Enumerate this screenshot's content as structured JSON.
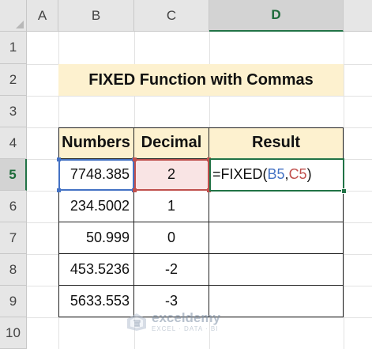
{
  "columns": [
    "A",
    "B",
    "C",
    "D"
  ],
  "rows": [
    "1",
    "2",
    "3",
    "4",
    "5",
    "6",
    "7",
    "8",
    "9",
    "10"
  ],
  "active_column": "D",
  "active_row": "5",
  "title": "FIXED Function with Commas",
  "table": {
    "headers": [
      "Numbers",
      "Decimal",
      "Result"
    ],
    "rows": [
      {
        "number": "7748.385",
        "decimal": "2"
      },
      {
        "number": "234.5002",
        "decimal": "1"
      },
      {
        "number": "50.999",
        "decimal": "0"
      },
      {
        "number": "453.5236",
        "decimal": "-2"
      },
      {
        "number": "5633.553",
        "decimal": "-3"
      }
    ]
  },
  "formula": {
    "prefix": "=FIXED(",
    "ref1": "B5",
    "sep": ",",
    "ref2": "C5",
    "suffix": ")"
  },
  "colors": {
    "ref1": "#4472c4",
    "ref2": "#c0504d",
    "active": "#217346",
    "header_fill": "#fdf1cf"
  },
  "watermark": {
    "name": "exceldemy",
    "tagline": "EXCEL · DATA · BI"
  }
}
